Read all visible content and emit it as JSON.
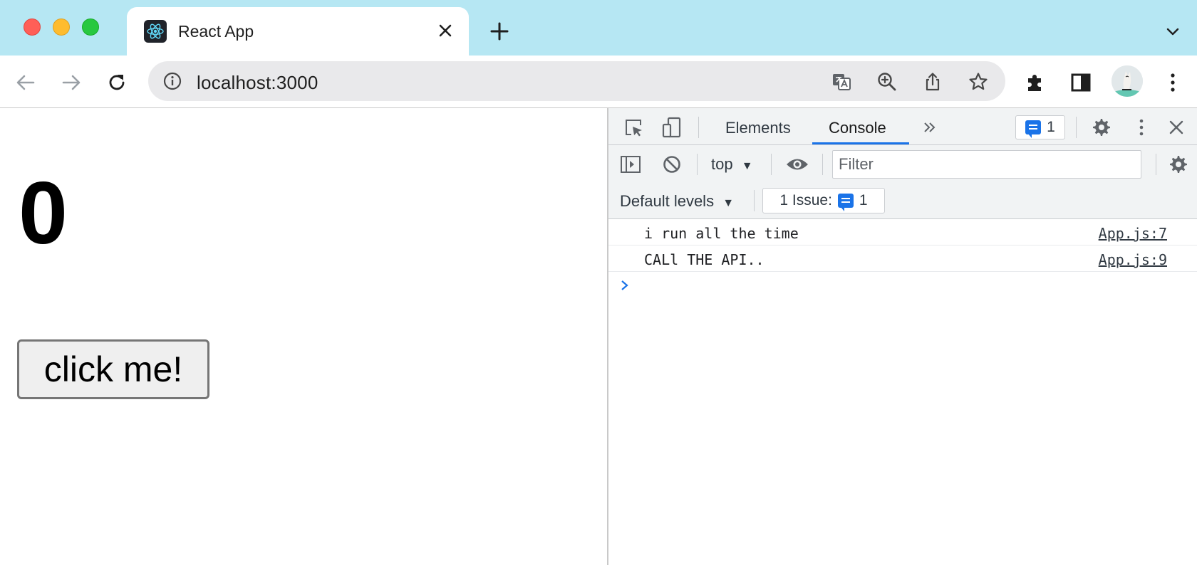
{
  "browser": {
    "tab": {
      "title": "React App"
    },
    "address": {
      "url": "localhost:3000"
    }
  },
  "page": {
    "counter": "0",
    "button_label": "click me!"
  },
  "devtools": {
    "tabs": [
      {
        "label": "Elements"
      },
      {
        "label": "Console"
      }
    ],
    "issue_badge_count": "1",
    "context": "top",
    "filter_placeholder": "Filter",
    "levels_label": "Default levels",
    "issues_label": "1 Issue:",
    "issues_count": "1",
    "console_logs": [
      {
        "message": "i run all the time",
        "source": "App.js:7"
      },
      {
        "message": "CALl THE API..",
        "source": "App.js:9"
      }
    ]
  },
  "colors": {
    "tab_strip": "#b6e7f3",
    "accent": "#1a73e8",
    "react_logo": "#61dafb"
  }
}
